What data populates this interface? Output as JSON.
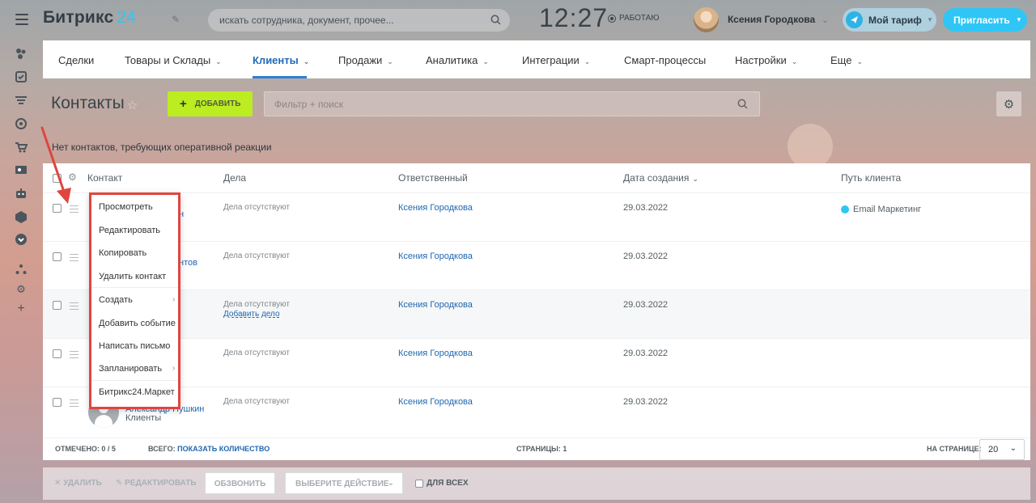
{
  "header": {
    "logo_text": "Битрикс",
    "logo_number": "24",
    "search_placeholder": "искать сотрудника, документ, прочее...",
    "clock": "12:27",
    "work_status": "РАБОТАЮ",
    "user_name": "Ксения Городкова",
    "tariff_label": "Мой тариф",
    "invite_label": "Пригласить"
  },
  "nav": {
    "tabs": [
      {
        "label": "Сделки",
        "has_menu": false
      },
      {
        "label": "Товары и Склады",
        "has_menu": true
      },
      {
        "label": "Клиенты",
        "has_menu": true,
        "active": true
      },
      {
        "label": "Продажи",
        "has_menu": true
      },
      {
        "label": "Аналитика",
        "has_menu": true
      },
      {
        "label": "Интеграции",
        "has_menu": true
      },
      {
        "label": "Смарт-процессы",
        "has_menu": false
      },
      {
        "label": "Настройки",
        "has_menu": true
      },
      {
        "label": "Еще",
        "has_menu": true
      }
    ]
  },
  "page": {
    "title": "Контакты",
    "add_button": "ДОБАВИТЬ",
    "filter_placeholder": "Фильтр + поиск",
    "reaction_text": "Нет контактов, требующих оперативной реакции"
  },
  "grid": {
    "columns": [
      "Контакт",
      "Дела",
      "Ответственный",
      "Дата создания",
      "Путь клиента"
    ],
    "rows": [
      {
        "contact_tail": "н",
        "deals": "Дела отсутствуют",
        "deals_link": "",
        "responsible": "Ксения Городкова",
        "created": "29.03.2022",
        "path": "Email Маркетинг"
      },
      {
        "contact_tail": "нтов",
        "deals": "Дела отсутствуют",
        "deals_link": "",
        "responsible": "Ксения Городкова",
        "created": "29.03.2022",
        "path": ""
      },
      {
        "contact_tail": "",
        "deals": "Дела отсутствуют",
        "deals_link": "Добавить дело",
        "responsible": "Ксения Городкова",
        "created": "29.03.2022",
        "path": ""
      },
      {
        "contact_tail": "",
        "deals": "Дела отсутствуют",
        "deals_link": "",
        "responsible": "Ксения Городкова",
        "created": "29.03.2022",
        "path": ""
      },
      {
        "contact_tail": "Александр Пушкин",
        "contact_sub": "Клиенты",
        "deals": "Дела отсутствуют",
        "deals_link": "",
        "responsible": "Ксения Городкова",
        "created": "29.03.2022",
        "path": ""
      }
    ],
    "footer": {
      "selected_label": "ОТМЕЧЕНО:",
      "selected_value": "0 / 5",
      "total_label": "ВСЕГО:",
      "total_link": "ПОКАЗАТЬ КОЛИЧЕСТВО",
      "pages_label": "СТРАНИЦЫ:",
      "pages_value": "1",
      "per_page_label": "НА СТРАНИЦЕ:",
      "per_page_value": "20"
    }
  },
  "context_menu": {
    "items": [
      {
        "label": "Просмотреть",
        "submenu": false
      },
      {
        "label": "Редактировать",
        "submenu": false
      },
      {
        "label": "Копировать",
        "submenu": false
      },
      {
        "label": "Удалить контакт",
        "submenu": false
      },
      {
        "label": "Создать",
        "submenu": true
      },
      {
        "label": "Добавить событие",
        "submenu": false
      },
      {
        "label": "Написать письмо",
        "submenu": false
      },
      {
        "label": "Запланировать",
        "submenu": true
      },
      {
        "label": "Битрикс24.Маркет",
        "submenu": false
      }
    ]
  },
  "actions": {
    "delete": "УДАЛИТЬ",
    "edit": "РЕДАКТИРОВАТЬ",
    "call": "ОБЗВОНИТЬ",
    "select_action": "ВЫБЕРИТЕ ДЕЙСТВИЕ",
    "for_all": "ДЛЯ ВСЕХ"
  },
  "colors": {
    "accent_blue": "#2fc6f6",
    "link_blue": "#2067b0",
    "add_green": "#bbed21",
    "annotation_red": "#e0453f"
  }
}
